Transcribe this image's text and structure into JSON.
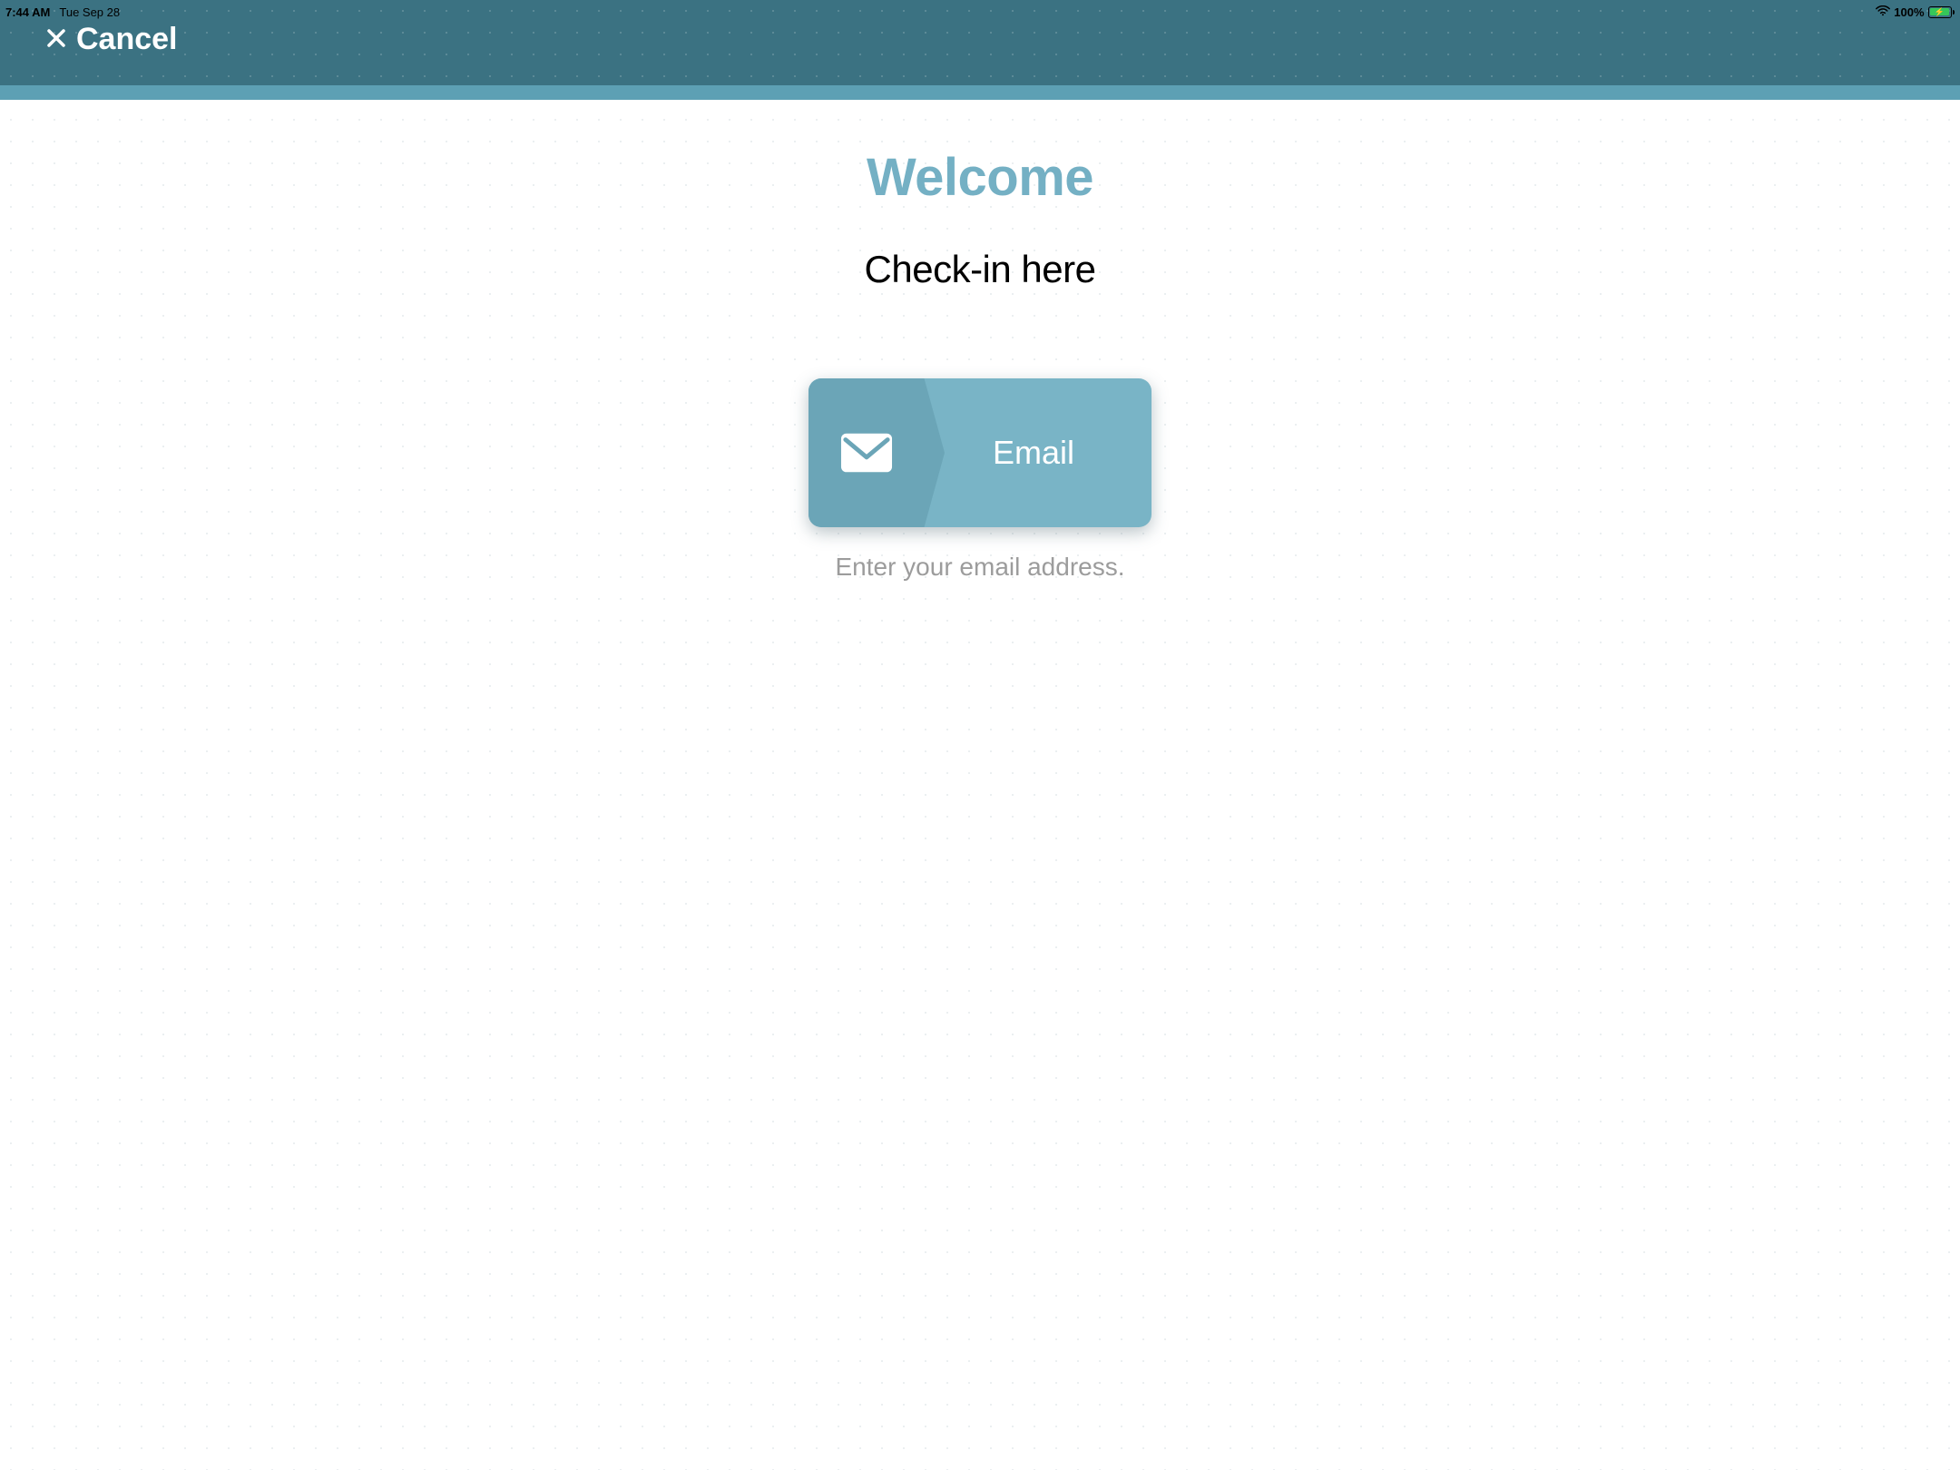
{
  "status_bar": {
    "time": "7:44 AM",
    "date": "Tue Sep 28",
    "battery_text": "100%"
  },
  "header": {
    "cancel_label": "Cancel"
  },
  "main": {
    "welcome_title": "Welcome",
    "subtitle": "Check-in here",
    "email_button_label": "Email",
    "email_helper_text": "Enter your email address."
  },
  "colors": {
    "header_bg": "#3b7282",
    "header_accent": "#5da0b4",
    "accent_text": "#74b0c4",
    "button_bg": "#79b4c6",
    "button_bg_dark": "#6ba5b7"
  }
}
